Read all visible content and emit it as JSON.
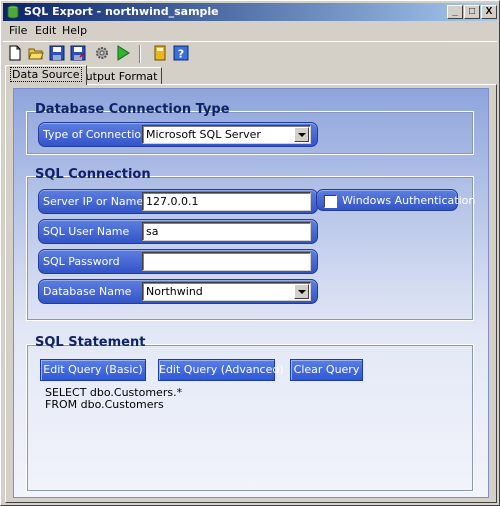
{
  "window": {
    "title": "SQL Export -  northwind_sample",
    "controls": {
      "minimize": "_",
      "maximize": "□",
      "close": "X"
    }
  },
  "menu": {
    "items": [
      "File",
      "Edit",
      "Help"
    ]
  },
  "toolbar": {
    "icons": [
      "new-file-icon",
      "open-folder-icon",
      "save-icon",
      "save-as-icon",
      "settings-gear-icon",
      "run-icon",
      "book-icon",
      "help-icon"
    ]
  },
  "tabs": [
    {
      "label": "Data Source",
      "active": true
    },
    {
      "label": "Output Format",
      "active": false
    }
  ],
  "connection_type": {
    "group_title": "Database Connection Type",
    "label": "Type of Connection",
    "value": "Microsoft SQL Server"
  },
  "sql_connection": {
    "group_title": "SQL Connection",
    "server": {
      "label": "Server IP or Name",
      "value": "127.0.0.1"
    },
    "user": {
      "label": "SQL User Name",
      "value": "sa"
    },
    "password": {
      "label": "SQL Password",
      "value": ""
    },
    "database": {
      "label": "Database Name",
      "value": "Northwind"
    },
    "windows_auth": {
      "label": "Windows Authentication",
      "checked": false
    }
  },
  "sql_statement": {
    "group_title": "SQL Statement",
    "buttons": {
      "edit_basic": "Edit Query (Basic)",
      "edit_advanced": "Edit Query (Advanced)",
      "clear": "Clear Query"
    },
    "query_lines": [
      "SELECT dbo.Customers.*",
      "FROM dbo.Customers"
    ]
  },
  "colors": {
    "title_bar_start": "#0a246a",
    "title_bar_end": "#a6caf0",
    "accent_blue": "#3354c8",
    "group_title": "#0f2268"
  }
}
